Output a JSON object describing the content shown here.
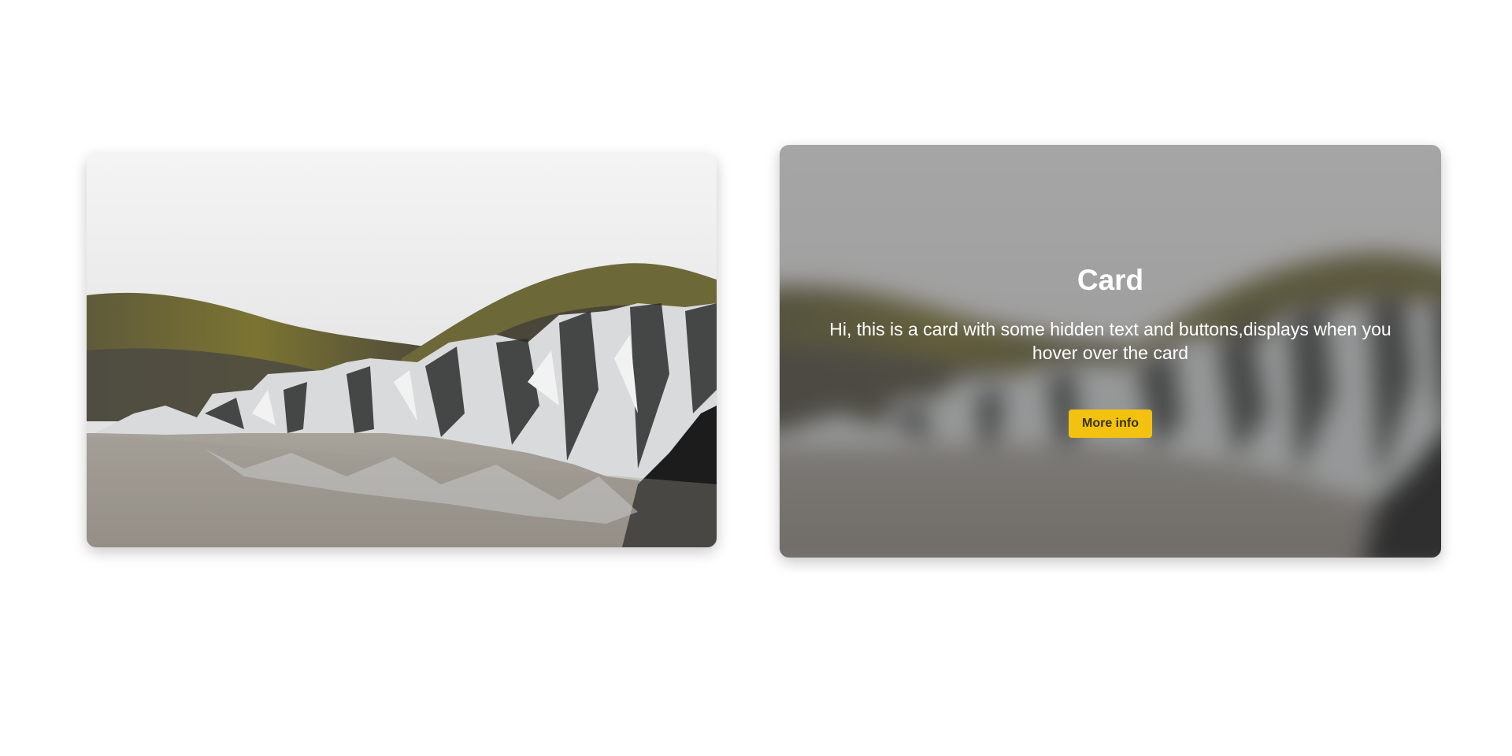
{
  "cards": [
    {
      "image": "glacier-landscape"
    },
    {
      "image": "glacier-landscape",
      "title": "Card",
      "text": "Hi, this is a card with some hidden text and buttons,displays when you hover over the card",
      "button_label": "More info"
    }
  ],
  "colors": {
    "button_background": "#f3c211",
    "overlay": "rgba(70, 70, 70, 0.45)",
    "page_background": "#ffffff"
  }
}
